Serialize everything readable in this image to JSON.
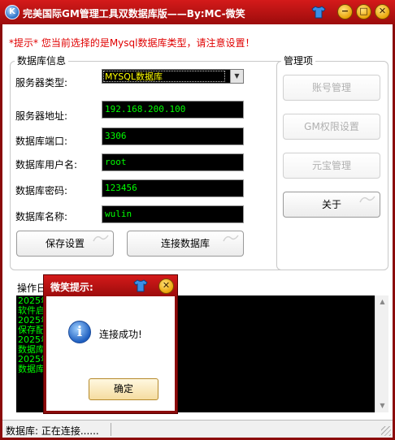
{
  "window": {
    "title": "完美国际GM管理工具双数据库版——By:MC-微笑",
    "app_icon_glyph": "K",
    "controls": {
      "minimize": "−",
      "maximize": "□",
      "close": "✕"
    }
  },
  "tip": "*提示*  您当前选择的是Mysql数据库类型，请注意设置！",
  "db_info": {
    "legend": "数据库信息",
    "server_type": {
      "label": "服务器类型:",
      "value": "MYSQL数据库"
    },
    "server_address": {
      "label": "服务器地址:",
      "value": "192.168.200.100"
    },
    "port": {
      "label": "数据库端口:",
      "value": "3306"
    },
    "user": {
      "label": "数据库用户名:",
      "value": "root"
    },
    "password": {
      "label": "数据库密码:",
      "value": "123456"
    },
    "db_name": {
      "label": "数据库名称:",
      "value": "wulin"
    },
    "save_button": "保存设置",
    "connect_button": "连接数据库"
  },
  "manage": {
    "legend": "管理项",
    "account_button": "账号管理",
    "gm_button": "GM权限设置",
    "yuanbao_button": "元宝管理",
    "about_button": "关于"
  },
  "log": {
    "legend": "操作日",
    "lines": [
      "2025年",
      "软件启",
      "2025年",
      "保存配",
      "2025年",
      "数据库",
      "2025年",
      "数据库"
    ]
  },
  "status_bar": {
    "text": "数据库: 正在连接......"
  },
  "dialog": {
    "title": "微笑提示:",
    "message": "连接成功!",
    "ok_button": "确定",
    "icon_glyph": "i"
  },
  "colors": {
    "frame": "#8b0a0a",
    "title_bar": "#c01212",
    "field_text": "#00ff00",
    "select_text": "#ffff00",
    "tip_text": "#e00000"
  }
}
